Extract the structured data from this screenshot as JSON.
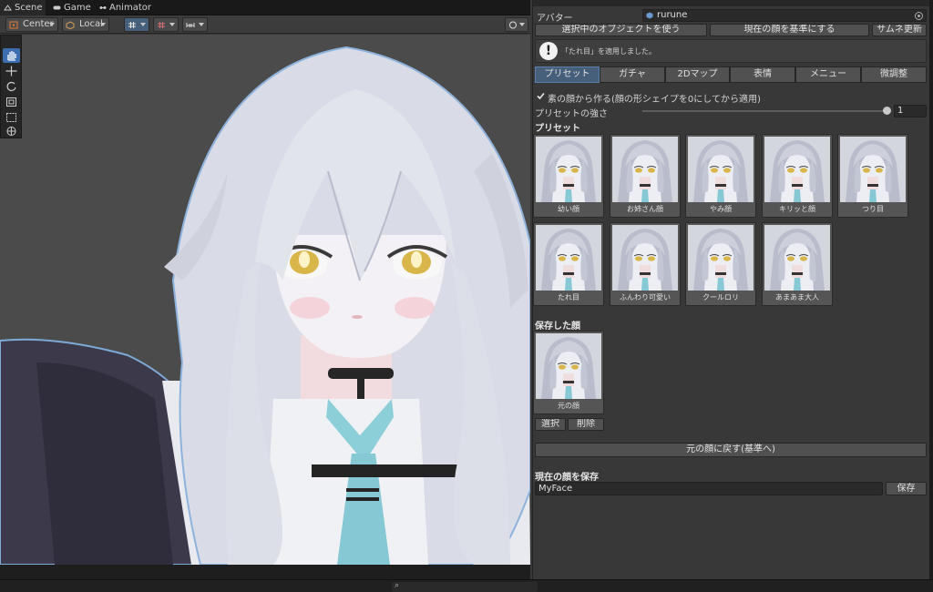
{
  "tabs": [
    "Scene",
    "Game",
    "Animator"
  ],
  "scene_toolbar": {
    "pivot": "Center",
    "space": "Local"
  },
  "avatar": {
    "label": "アバター",
    "value": "rurune"
  },
  "actions": {
    "use_selected": "選択中のオブジェクトを使う",
    "set_base": "現在の顔を基準にする",
    "refresh_thumbs": "サムネ更新"
  },
  "help_message": "「たれ目」を適用しました。",
  "mode_tabs": [
    "プリセット",
    "ガチャ",
    "2Dマップ",
    "表情",
    "メニュー",
    "微調整"
  ],
  "options": {
    "from_plain_face": "素の顔から作る(顔の形シェイプを0にしてから適用)",
    "strength_label": "プリセットの強さ",
    "strength_value": "1"
  },
  "strength_level": 1.0,
  "presets_title": "プリセット",
  "presets": [
    "幼い顔",
    "お姉さん顔",
    "やみ顔",
    "キリッと顔",
    "つり目",
    "たれ目",
    "ふんわり可愛い",
    "クールロリ",
    "あまあま大人"
  ],
  "saved_title": "保存した顔",
  "saved": [
    "元の顔"
  ],
  "saved_actions": {
    "select": "選択",
    "delete": "削除"
  },
  "revert_button": "元の顔に戻す(基準へ)",
  "save_section": {
    "title": "現在の顔を保存",
    "name_value": "MyFace",
    "save_button": "保存"
  },
  "colors": {
    "accent": "#46607c",
    "panel_bg": "#383838",
    "hair": "#e4e6ee",
    "tie": "#86c9d4",
    "eyes": "#d9b64a"
  },
  "icons": [
    "hand-tool-icon",
    "move-tool-icon",
    "rotate-tool-icon",
    "scale-tool-icon",
    "rect-tool-icon",
    "transform-tool-icon"
  ]
}
